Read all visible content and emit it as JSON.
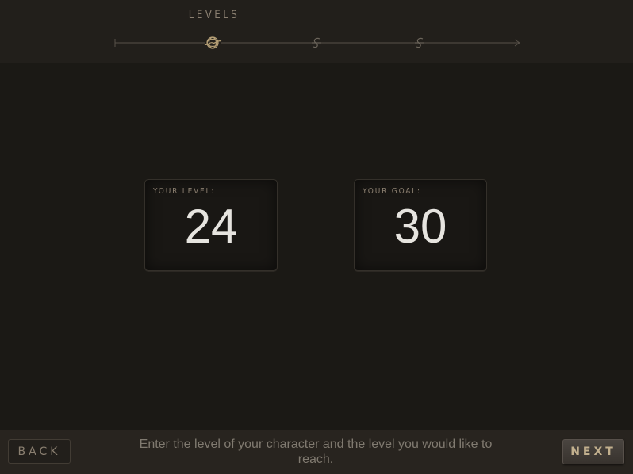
{
  "header": {
    "step_title": "LEVELS",
    "steps": [
      {
        "name": "levels",
        "state": "current"
      },
      {
        "name": "step-2",
        "state": "upcoming"
      },
      {
        "name": "step-3",
        "state": "upcoming"
      }
    ]
  },
  "cards": {
    "level": {
      "label": "YOUR LEVEL:",
      "value": "24"
    },
    "goal": {
      "label": "YOUR GOAL:",
      "value": "30"
    }
  },
  "footer": {
    "back_label": "BACK",
    "next_label": "NEXT",
    "instructions": "Enter the level of your character and the level you would like to reach."
  },
  "colors": {
    "background": "#1b1915",
    "header_bg": "#221f1b",
    "footer_bg": "#28241f",
    "muted_text": "#8a7f70",
    "value_text": "#e6e4df",
    "accent": "#c2b08e"
  }
}
